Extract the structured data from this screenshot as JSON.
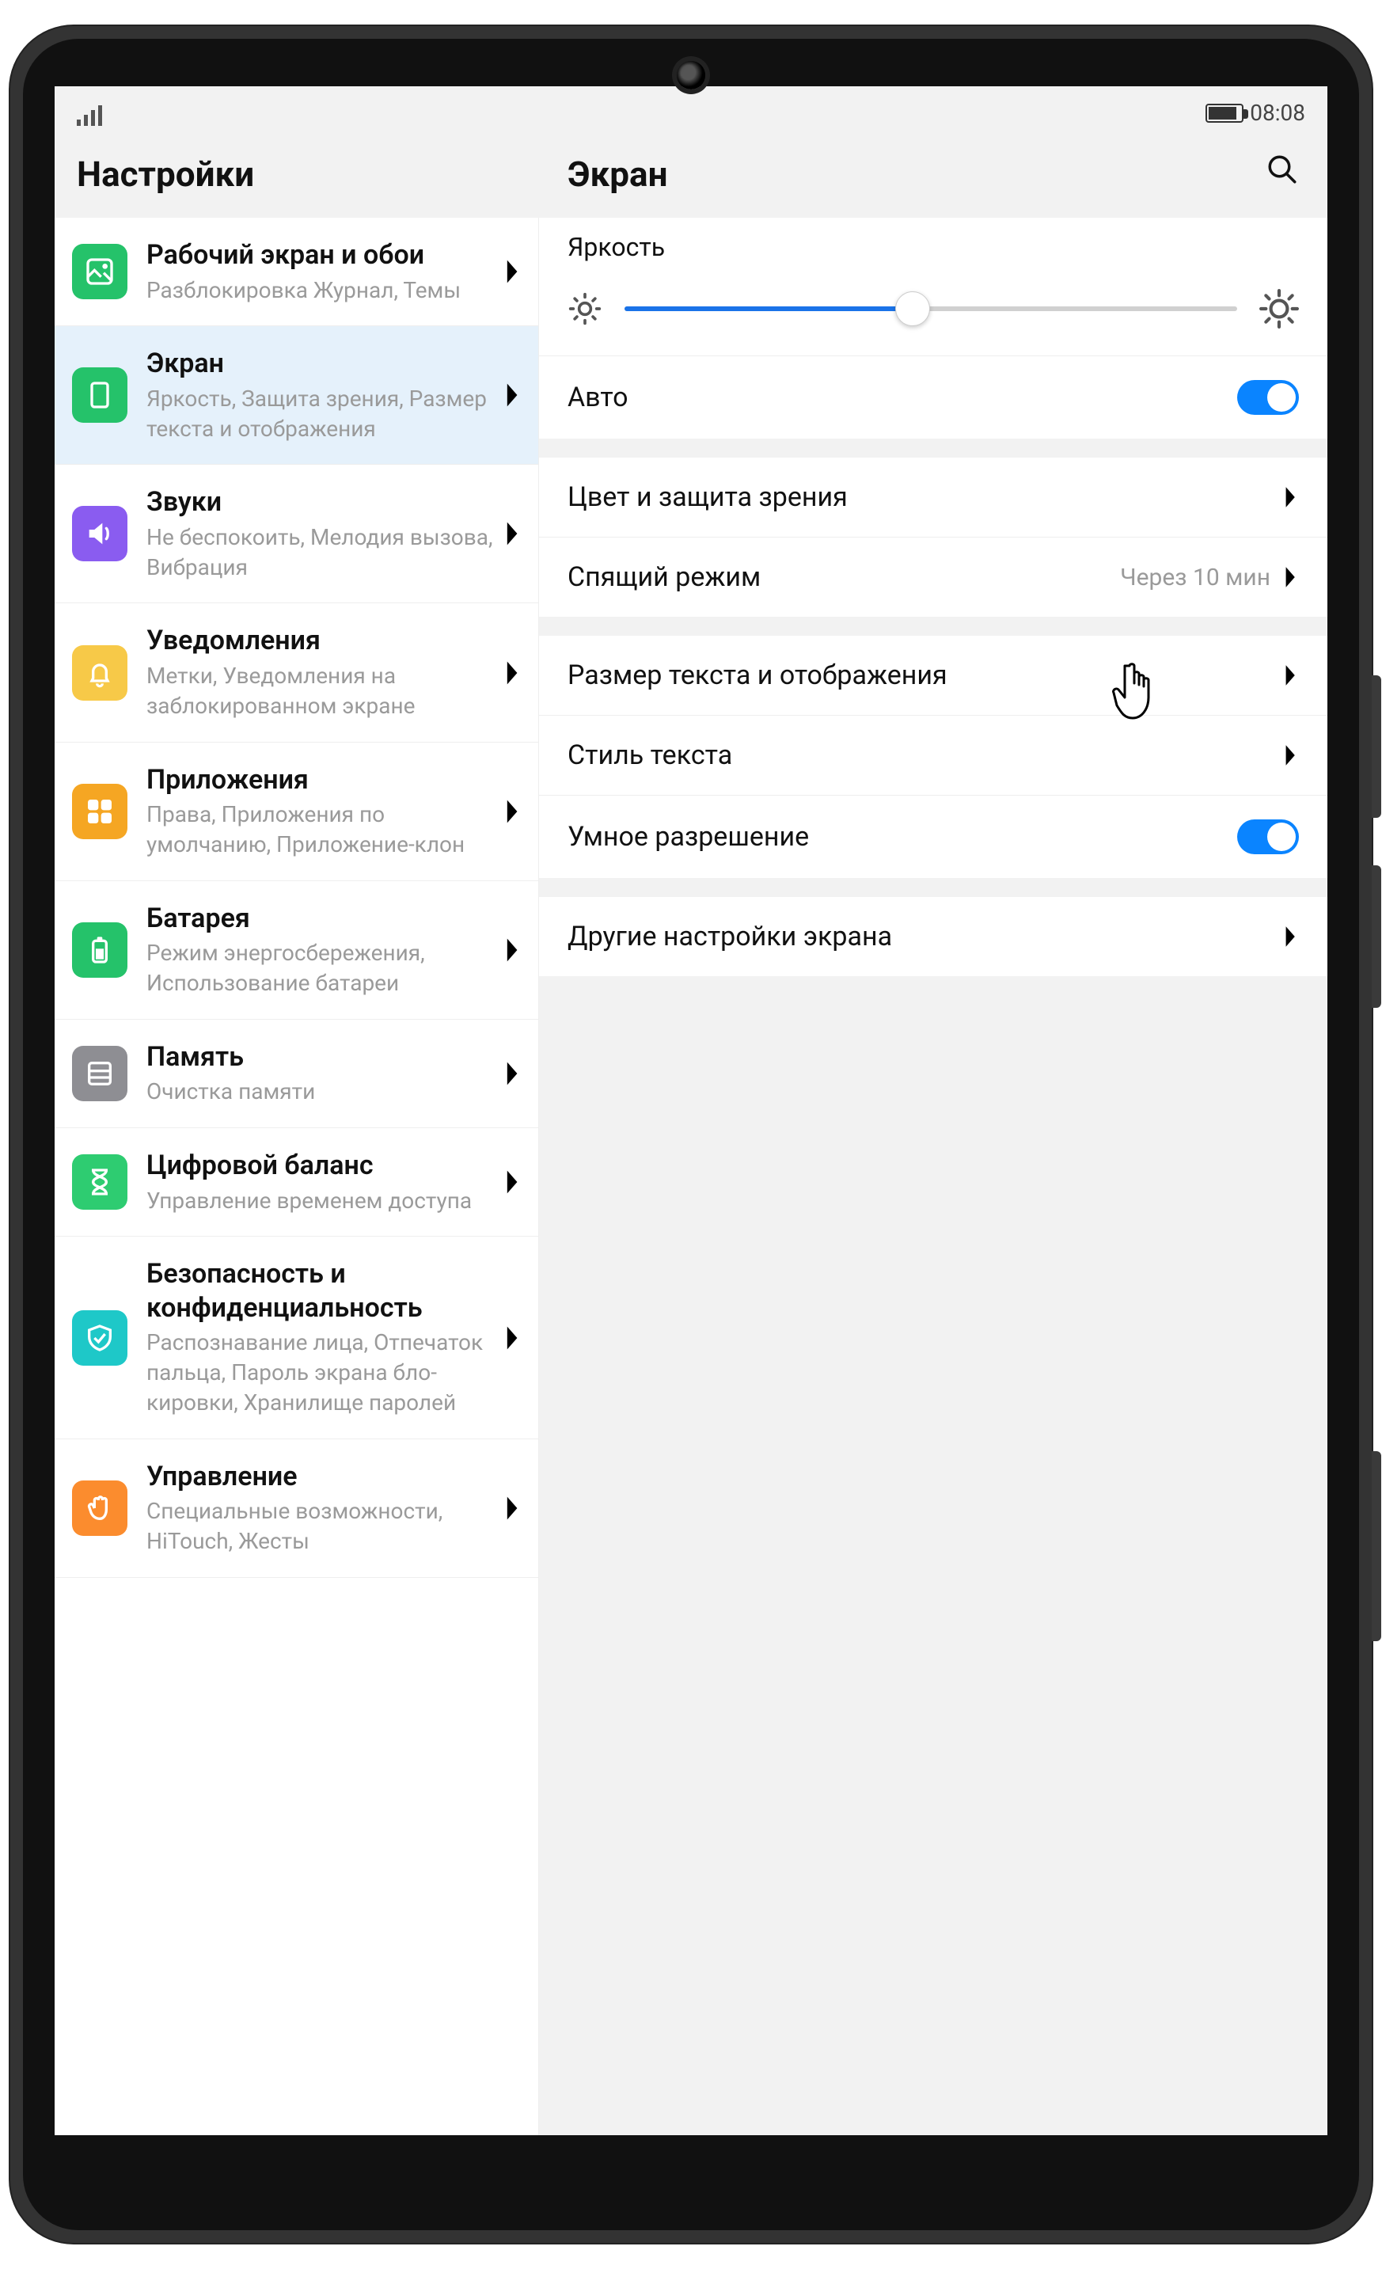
{
  "statusbar": {
    "time": "08:08"
  },
  "header": {
    "left_title": "Настройки",
    "right_title": "Экран"
  },
  "sidebar": {
    "items": [
      {
        "title": "Рабочий экран и обои",
        "sub": "Разблокировка Журнал, Темы"
      },
      {
        "title": "Экран",
        "sub": "Яркость, Защита зрения, Размер текста и отображения"
      },
      {
        "title": "Звуки",
        "sub": "Не беспокоить, Мелодия вызова, Вибрация"
      },
      {
        "title": "Уведомления",
        "sub": "Метки, Уведомления на заблокированном экране"
      },
      {
        "title": "Приложения",
        "sub": "Права, Приложения по умолчанию, Приложение-клон"
      },
      {
        "title": "Батарея",
        "sub": "Режим энергосбере­жения, Использование батареи"
      },
      {
        "title": "Память",
        "sub": "Очистка памяти"
      },
      {
        "title": "Цифровой баланс",
        "sub": "Управление временем доступа"
      },
      {
        "title": "Безопасность и конфиденциаль­ность",
        "sub": "Распознавание лица, Отпечаток пальца, Пароль экрана бло­кировки, Хранилище паролей"
      },
      {
        "title": "Управление",
        "sub": "Специальные возможности, HiTouch, Жесты"
      }
    ]
  },
  "detail": {
    "brightness_label": "Яркость",
    "brightness_percent": 47,
    "auto_label": "Авто",
    "auto_on": true,
    "color_protection": "Цвет и защита зрения",
    "sleep_label": "Спящий режим",
    "sleep_value": "Через 10 мин",
    "text_size": "Размер текста и отображения",
    "text_style": "Стиль текста",
    "smart_res_label": "Умное разрешение",
    "smart_res_on": true,
    "other": "Другие настройки экрана"
  }
}
